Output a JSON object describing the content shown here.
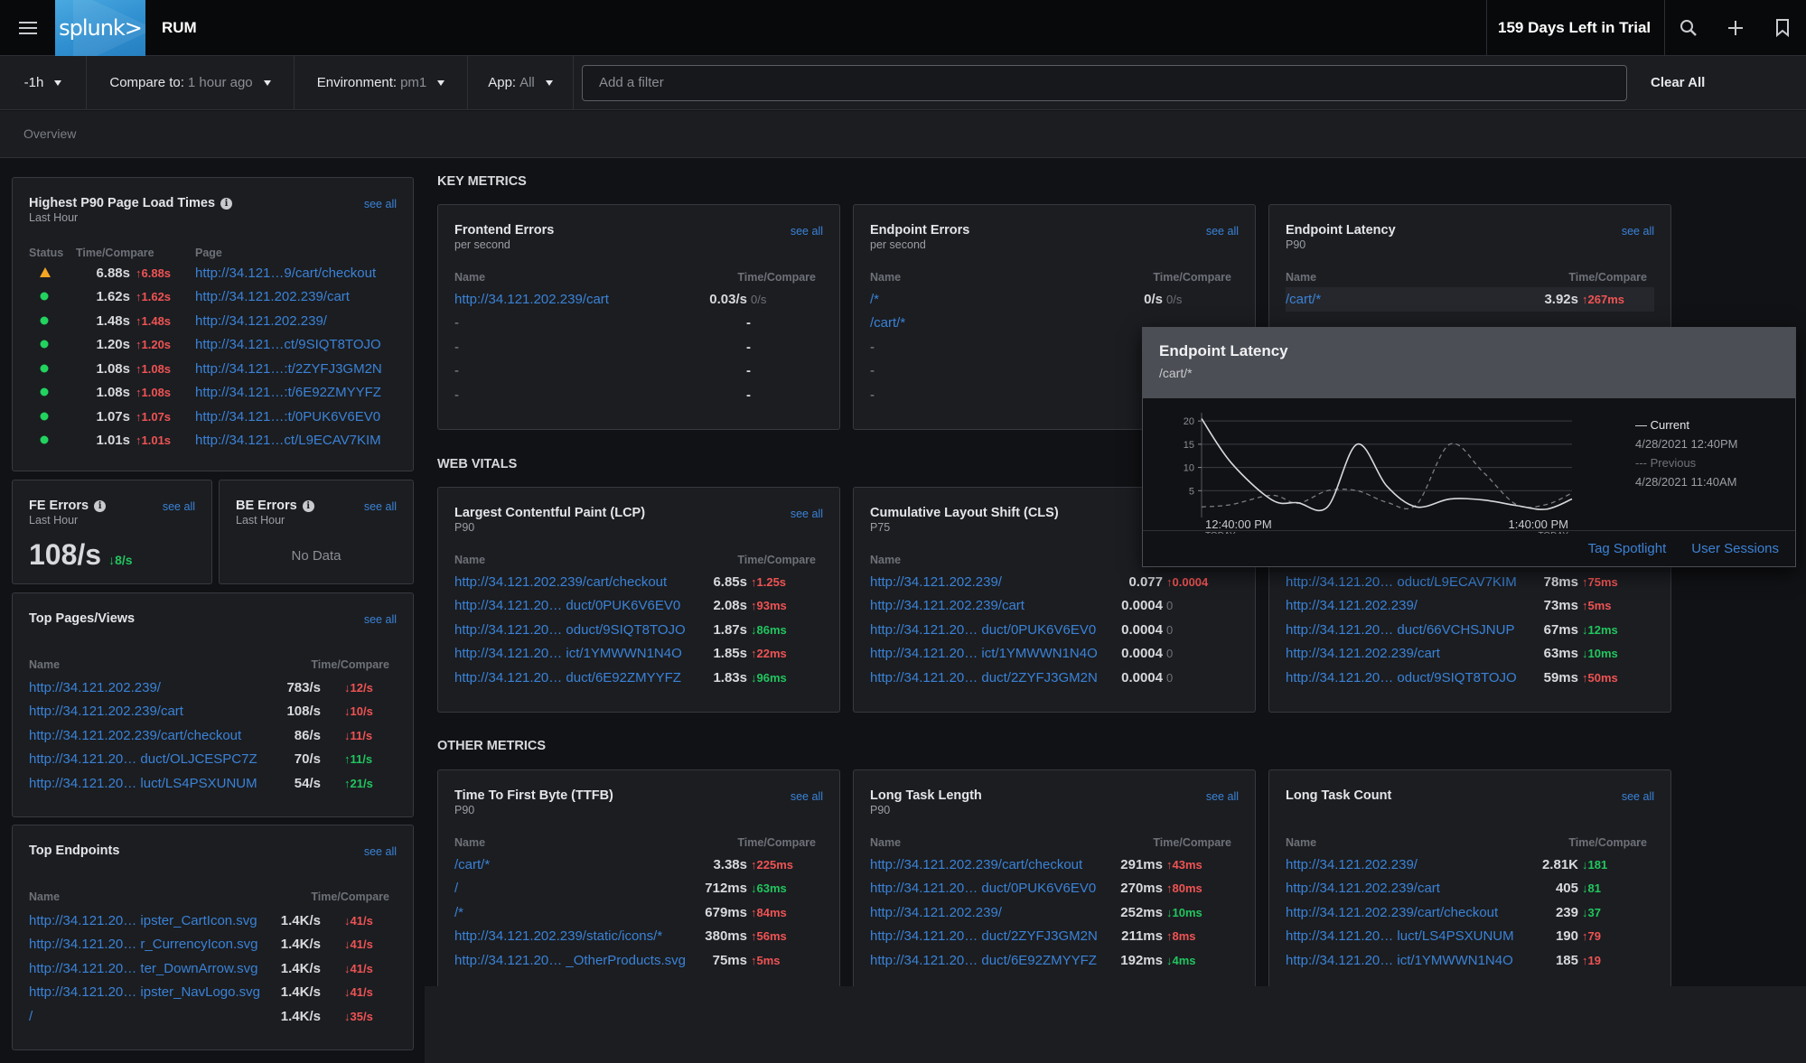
{
  "topbar": {
    "logo_text": "splunk>",
    "app_title": "RUM",
    "trial_text": "159 Days Left in Trial",
    "icons": [
      "hamburger-menu-icon",
      "search-icon",
      "plus-icon",
      "bookmark-icon"
    ]
  },
  "filters": {
    "time_range": "-1h",
    "compare_label": "Compare to:",
    "compare_value": "1 hour ago",
    "environment_label": "Environment:",
    "environment_value": "pm1",
    "app_label": "App:",
    "app_value": "All",
    "add_filter_placeholder": "Add a filter",
    "clear_all": "Clear All"
  },
  "breadcrumb": {
    "tab": "Overview"
  },
  "left": {
    "page_load": {
      "title": "Highest P90 Page Load Times",
      "subtitle": "Last Hour",
      "see_all": "see all",
      "headers": {
        "status": "Status",
        "time": "Time/Compare",
        "page": "Page"
      },
      "rows": [
        {
          "status": "warning",
          "time": "6.88s",
          "compare": "6.88s",
          "dir": "up",
          "page": "http://34.121…9/cart/checkout"
        },
        {
          "status": "ok",
          "time": "1.62s",
          "compare": "1.62s",
          "dir": "up",
          "page": "http://34.121.202.239/cart"
        },
        {
          "status": "ok",
          "time": "1.48s",
          "compare": "1.48s",
          "dir": "up",
          "page": "http://34.121.202.239/"
        },
        {
          "status": "ok",
          "time": "1.20s",
          "compare": "1.20s",
          "dir": "up",
          "page": "http://34.121…ct/9SIQT8TOJO"
        },
        {
          "status": "ok",
          "time": "1.08s",
          "compare": "1.08s",
          "dir": "up",
          "page": "http://34.121…:t/2ZYFJ3GM2N"
        },
        {
          "status": "ok",
          "time": "1.08s",
          "compare": "1.08s",
          "dir": "up",
          "page": "http://34.121…:t/6E92ZMYYFZ"
        },
        {
          "status": "ok",
          "time": "1.07s",
          "compare": "1.07s",
          "dir": "up",
          "page": "http://34.121…:t/0PUK6V6EV0"
        },
        {
          "status": "ok",
          "time": "1.01s",
          "compare": "1.01s",
          "dir": "up",
          "page": "http://34.121…ct/L9ECAV7KIM"
        }
      ]
    },
    "fe_errors": {
      "title": "FE Errors",
      "subtitle": "Last Hour",
      "see_all": "see all",
      "value": "108/s",
      "compare": "8/s",
      "dir": "down"
    },
    "be_errors": {
      "title": "BE Errors",
      "subtitle": "Last Hour",
      "see_all": "see all",
      "empty": "No Data"
    },
    "top_pages": {
      "title": "Top Pages/Views",
      "see_all": "see all",
      "headers": {
        "name": "Name",
        "time": "Time/Compare"
      },
      "rows": [
        {
          "name": "http://34.121.202.239/",
          "value": "783/s",
          "compare": "12/s",
          "dir": "down",
          "tone": "up"
        },
        {
          "name": "http://34.121.202.239/cart",
          "value": "108/s",
          "compare": "10/s",
          "dir": "down",
          "tone": "up"
        },
        {
          "name": "http://34.121.202.239/cart/checkout",
          "value": "86/s",
          "compare": "11/s",
          "dir": "down",
          "tone": "up"
        },
        {
          "name": "http://34.121.20… duct/OLJCESPC7Z",
          "value": "70/s",
          "compare": "11/s",
          "dir": "up",
          "tone": "down"
        },
        {
          "name": "http://34.121.20… luct/LS4PSXUNUM",
          "value": "54/s",
          "compare": "21/s",
          "dir": "up",
          "tone": "down"
        }
      ]
    },
    "top_endpoints": {
      "title": "Top Endpoints",
      "see_all": "see all",
      "headers": {
        "name": "Name",
        "time": "Time/Compare"
      },
      "rows": [
        {
          "name": "http://34.121.20… ipster_CartIcon.svg",
          "value": "1.4K/s",
          "compare": "41/s",
          "dir": "down",
          "tone": "up"
        },
        {
          "name": "http://34.121.20… r_CurrencyIcon.svg",
          "value": "1.4K/s",
          "compare": "41/s",
          "dir": "down",
          "tone": "up"
        },
        {
          "name": "http://34.121.20… ter_DownArrow.svg",
          "value": "1.4K/s",
          "compare": "41/s",
          "dir": "down",
          "tone": "up"
        },
        {
          "name": "http://34.121.20… ipster_NavLogo.svg",
          "value": "1.4K/s",
          "compare": "41/s",
          "dir": "down",
          "tone": "up"
        },
        {
          "name": "/",
          "value": "1.4K/s",
          "compare": "35/s",
          "dir": "down",
          "tone": "up"
        }
      ]
    }
  },
  "sections": {
    "key_metrics": "KEY METRICS",
    "web_vitals": "WEB VITALS",
    "other_metrics": "OTHER METRICS"
  },
  "cards": {
    "frontend_errors": {
      "title": "Frontend Errors",
      "subtitle": "per second",
      "see_all": "see all",
      "headers": {
        "name": "Name",
        "time": "Time/Compare"
      },
      "rows": [
        {
          "name": "http://34.121.202.239/cart",
          "value": "0.03/s",
          "compare": "0/s",
          "dir": "none"
        },
        {
          "name": "-",
          "value": "-",
          "compare": "",
          "dir": "none"
        },
        {
          "name": "-",
          "value": "-",
          "compare": "",
          "dir": "none"
        },
        {
          "name": "-",
          "value": "-",
          "compare": "",
          "dir": "none"
        },
        {
          "name": "-",
          "value": "-",
          "compare": "",
          "dir": "none"
        }
      ]
    },
    "endpoint_errors": {
      "title": "Endpoint Errors",
      "subtitle": "per second",
      "see_all": "see all",
      "headers": {
        "name": "Name",
        "time": "Time/Compare"
      },
      "rows": [
        {
          "name": "/*",
          "value": "0/s",
          "compare": "0/s",
          "dir": "none"
        },
        {
          "name": "/cart/*",
          "value": "",
          "compare": "",
          "dir": "none"
        },
        {
          "name": "-",
          "value": "",
          "compare": "",
          "dir": "none"
        },
        {
          "name": "-",
          "value": "",
          "compare": "",
          "dir": "none"
        },
        {
          "name": "-",
          "value": "",
          "compare": "",
          "dir": "none"
        }
      ]
    },
    "endpoint_latency": {
      "title": "Endpoint Latency",
      "subtitle": "P90",
      "see_all": "see all",
      "headers": {
        "name": "Name",
        "time": "Time/Compare"
      },
      "rows": [
        {
          "name": "/cart/*",
          "value": "3.92s",
          "compare": "267ms",
          "dir": "up"
        }
      ]
    },
    "lcp": {
      "title": "Largest Contentful Paint (LCP)",
      "subtitle": "P90",
      "see_all": "see all",
      "headers": {
        "name": "Name",
        "time": "Time/Compare"
      },
      "rows": [
        {
          "name": "http://34.121.202.239/cart/checkout",
          "value": "6.85s",
          "compare": "1.25s",
          "dir": "up"
        },
        {
          "name": "http://34.121.20… duct/0PUK6V6EV0",
          "value": "2.08s",
          "compare": "93ms",
          "dir": "up"
        },
        {
          "name": "http://34.121.20… oduct/9SIQT8TOJO",
          "value": "1.87s",
          "compare": "86ms",
          "dir": "down"
        },
        {
          "name": "http://34.121.20… ict/1YMWWN1N4O",
          "value": "1.85s",
          "compare": "22ms",
          "dir": "up"
        },
        {
          "name": "http://34.121.20… duct/6E92ZMYYFZ",
          "value": "1.83s",
          "compare": "96ms",
          "dir": "down"
        }
      ]
    },
    "cls": {
      "title": "Cumulative Layout Shift (CLS)",
      "subtitle": "P75",
      "see_all": "see all",
      "headers": {
        "name": "Name",
        "time": "Time/Compare"
      },
      "rows": [
        {
          "name": "http://34.121.202.239/",
          "value": "0.077",
          "compare": "0.0004",
          "dir": "up"
        },
        {
          "name": "http://34.121.202.239/cart",
          "value": "0.0004",
          "compare": "0",
          "dir": "none"
        },
        {
          "name": "http://34.121.20… duct/0PUK6V6EV0",
          "value": "0.0004",
          "compare": "0",
          "dir": "none"
        },
        {
          "name": "http://34.121.20… ict/1YMWWN1N4O",
          "value": "0.0004",
          "compare": "0",
          "dir": "none"
        },
        {
          "name": "http://34.121.20… duct/2ZYFJ3GM2N",
          "value": "0.0004",
          "compare": "0",
          "dir": "none"
        }
      ]
    },
    "fid": {
      "rows": [
        {
          "name": "http://34.121.20… oduct/L9ECAV7KIM",
          "value": "78ms",
          "compare": "75ms",
          "dir": "up"
        },
        {
          "name": "http://34.121.202.239/",
          "value": "73ms",
          "compare": "5ms",
          "dir": "up"
        },
        {
          "name": "http://34.121.20… duct/66VCHSJNUP",
          "value": "67ms",
          "compare": "12ms",
          "dir": "down"
        },
        {
          "name": "http://34.121.202.239/cart",
          "value": "63ms",
          "compare": "10ms",
          "dir": "down"
        },
        {
          "name": "http://34.121.20… oduct/9SIQT8TOJO",
          "value": "59ms",
          "compare": "50ms",
          "dir": "up"
        }
      ]
    },
    "ttfb": {
      "title": "Time To First Byte (TTFB)",
      "subtitle": "P90",
      "see_all": "see all",
      "headers": {
        "name": "Name",
        "time": "Time/Compare"
      },
      "rows": [
        {
          "name": "/cart/*",
          "value": "3.38s",
          "compare": "225ms",
          "dir": "up"
        },
        {
          "name": "/",
          "value": "712ms",
          "compare": "63ms",
          "dir": "down"
        },
        {
          "name": "/*",
          "value": "679ms",
          "compare": "84ms",
          "dir": "up"
        },
        {
          "name": "http://34.121.202.239/static/icons/*",
          "value": "380ms",
          "compare": "56ms",
          "dir": "up"
        },
        {
          "name": "http://34.121.20… _OtherProducts.svg",
          "value": "75ms",
          "compare": "5ms",
          "dir": "up"
        }
      ]
    },
    "long_task_length": {
      "title": "Long Task Length",
      "subtitle": "P90",
      "see_all": "see all",
      "headers": {
        "name": "Name",
        "time": "Time/Compare"
      },
      "rows": [
        {
          "name": "http://34.121.202.239/cart/checkout",
          "value": "291ms",
          "compare": "43ms",
          "dir": "up"
        },
        {
          "name": "http://34.121.20… duct/0PUK6V6EV0",
          "value": "270ms",
          "compare": "80ms",
          "dir": "up"
        },
        {
          "name": "http://34.121.202.239/",
          "value": "252ms",
          "compare": "10ms",
          "dir": "down"
        },
        {
          "name": "http://34.121.20… duct/2ZYFJ3GM2N",
          "value": "211ms",
          "compare": "8ms",
          "dir": "up"
        },
        {
          "name": "http://34.121.20… duct/6E92ZMYYFZ",
          "value": "192ms",
          "compare": "4ms",
          "dir": "down"
        }
      ]
    },
    "long_task_count": {
      "title": "Long Task Count",
      "subtitle": "",
      "see_all": "see all",
      "headers": {
        "name": "Name",
        "time": "Time/Compare"
      },
      "rows": [
        {
          "name": "http://34.121.202.239/",
          "value": "2.81K",
          "compare": "181",
          "dir": "down"
        },
        {
          "name": "http://34.121.202.239/cart",
          "value": "405",
          "compare": "81",
          "dir": "down"
        },
        {
          "name": "http://34.121.202.239/cart/checkout",
          "value": "239",
          "compare": "37",
          "dir": "down"
        },
        {
          "name": "http://34.121.20… luct/LS4PSXUNUM",
          "value": "190",
          "compare": "79",
          "dir": "up"
        },
        {
          "name": "http://34.121.20… ict/1YMWWN1N4O",
          "value": "185",
          "compare": "19",
          "dir": "up"
        }
      ]
    }
  },
  "popup": {
    "title": "Endpoint Latency",
    "subtitle": "/cart/*",
    "legend_current": "— Current",
    "legend_current_date": "4/28/2021 12:40PM",
    "legend_previous": "--- Previous",
    "legend_previous_date": "4/28/2021 11:40AM",
    "tag_spotlight": "Tag Spotlight",
    "user_sessions": "User Sessions"
  },
  "chart_data": {
    "type": "line",
    "title": "Endpoint Latency /cart/*",
    "xlabel": "",
    "ylabel": "",
    "x_tick_labels": [
      [
        "12:40:00 PM",
        "TODAY"
      ],
      [
        "1:40:00 PM",
        "TODAY"
      ]
    ],
    "y_ticks": [
      5,
      10,
      15,
      20
    ],
    "ylim": [
      0,
      21
    ],
    "grid": true,
    "legend": "right",
    "x": [
      0,
      0.08,
      0.19,
      0.26,
      0.34,
      0.42,
      0.5,
      0.58,
      0.67,
      0.76,
      0.85,
      0.93,
      1.0
    ],
    "series": [
      {
        "name": "Current",
        "style": "solid",
        "values": [
          20.5,
          11,
          3,
          2.4,
          1.5,
          15,
          6,
          1.5,
          3.2,
          3,
          1.8,
          1,
          3.2
        ]
      },
      {
        "name": "Previous",
        "style": "dashed",
        "values": [
          1.5,
          2,
          4,
          2.3,
          5,
          5,
          2.5,
          2,
          15,
          9,
          2,
          2,
          4.5
        ]
      }
    ]
  }
}
